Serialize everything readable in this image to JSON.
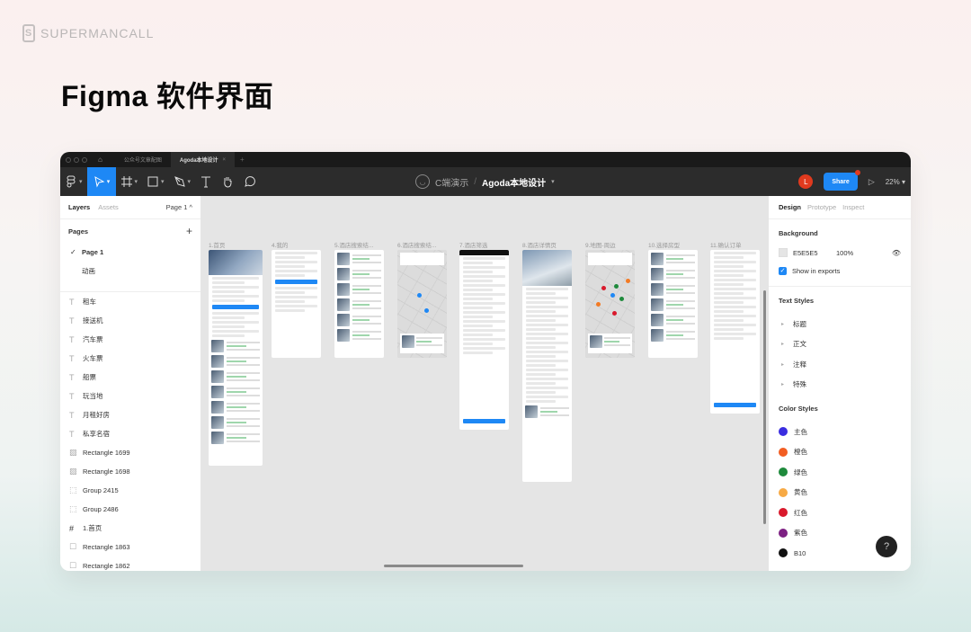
{
  "brand": {
    "logo": "S",
    "name": "SUPERMANCALL"
  },
  "headline": "Figma 软件界面",
  "window": {
    "tabs": [
      {
        "label": "公众号文章配图",
        "active": false
      },
      {
        "label": "Agoda本地设计",
        "active": true,
        "close": "×"
      }
    ],
    "new_tab": "+",
    "toolbar": {
      "project": "C端演示",
      "separator": "/",
      "file_name": "Agoda本地设计",
      "user_initial": "L",
      "share_label": "Share",
      "play": "▷",
      "zoom_level": "22%"
    },
    "left_panel": {
      "tabs": [
        "Layers",
        "Assets"
      ],
      "page_selector": "Page 1 ^",
      "pages_heading": "Pages",
      "add_page": "+",
      "pages": [
        {
          "label": "Page 1",
          "current": true
        },
        {
          "label": "动画",
          "current": false
        }
      ],
      "layers": [
        {
          "type": "text",
          "icon": "T",
          "label": "租车"
        },
        {
          "type": "text",
          "icon": "T",
          "label": "接送机"
        },
        {
          "type": "text",
          "icon": "T",
          "label": "汽车票"
        },
        {
          "type": "text",
          "icon": "T",
          "label": "火车票"
        },
        {
          "type": "text",
          "icon": "T",
          "label": "船票"
        },
        {
          "type": "text",
          "icon": "T",
          "label": "玩当地"
        },
        {
          "type": "text",
          "icon": "T",
          "label": "月租好房"
        },
        {
          "type": "text",
          "icon": "T",
          "label": "私享名宿"
        },
        {
          "type": "image",
          "icon": "▨",
          "label": "Rectangle 1699"
        },
        {
          "type": "image",
          "icon": "▨",
          "label": "Rectangle 1698"
        },
        {
          "type": "group",
          "icon": "⬚",
          "label": "Group 2415"
        },
        {
          "type": "group",
          "icon": "⬚",
          "label": "Group 2486"
        },
        {
          "type": "frame",
          "icon": "#",
          "label": "1.首页"
        },
        {
          "type": "rect",
          "icon": "☐",
          "label": "Rectangle 1863"
        },
        {
          "type": "rect",
          "icon": "☐",
          "label": "Rectangle 1862"
        }
      ]
    },
    "canvas": {
      "frames": [
        {
          "label": "1.首页"
        },
        {
          "label": "4.我的"
        },
        {
          "label": "5.酒店搜索结..."
        },
        {
          "label": "6.酒店搜索结..."
        },
        {
          "label": "7.酒店筛选"
        },
        {
          "label": "8.酒店详情页"
        },
        {
          "label": "9.地图-周边"
        },
        {
          "label": "10.选择房型"
        },
        {
          "label": "11.确认订单"
        }
      ]
    },
    "right_panel": {
      "tabs": [
        "Design",
        "Prototype",
        "Inspect"
      ],
      "background": {
        "heading": "Background",
        "hex": "E5E5E5",
        "opacity": "100%",
        "show_in_exports_label": "Show in exports",
        "show_in_exports": true
      },
      "text_styles": {
        "heading": "Text Styles",
        "items": [
          "标题",
          "正文",
          "注释",
          "特殊"
        ]
      },
      "color_styles": {
        "heading": "Color Styles",
        "items": [
          {
            "label": "主色",
            "color": "#3a2de0"
          },
          {
            "label": "橙色",
            "color": "#f25d22"
          },
          {
            "label": "绿色",
            "color": "#1e8a3c"
          },
          {
            "label": "黄色",
            "color": "#f7aa45"
          },
          {
            "label": "红色",
            "color": "#d9192c"
          },
          {
            "label": "紫色",
            "color": "#7d2183"
          },
          {
            "label": "B10",
            "color": "#111111"
          }
        ]
      }
    },
    "help_label": "?"
  },
  "colors": {
    "accent": "#1e88f5",
    "toolbar_bg": "#2c2c2c",
    "canvas_bg": "#E5E5E5",
    "user_avatar": "#e03a1e"
  }
}
